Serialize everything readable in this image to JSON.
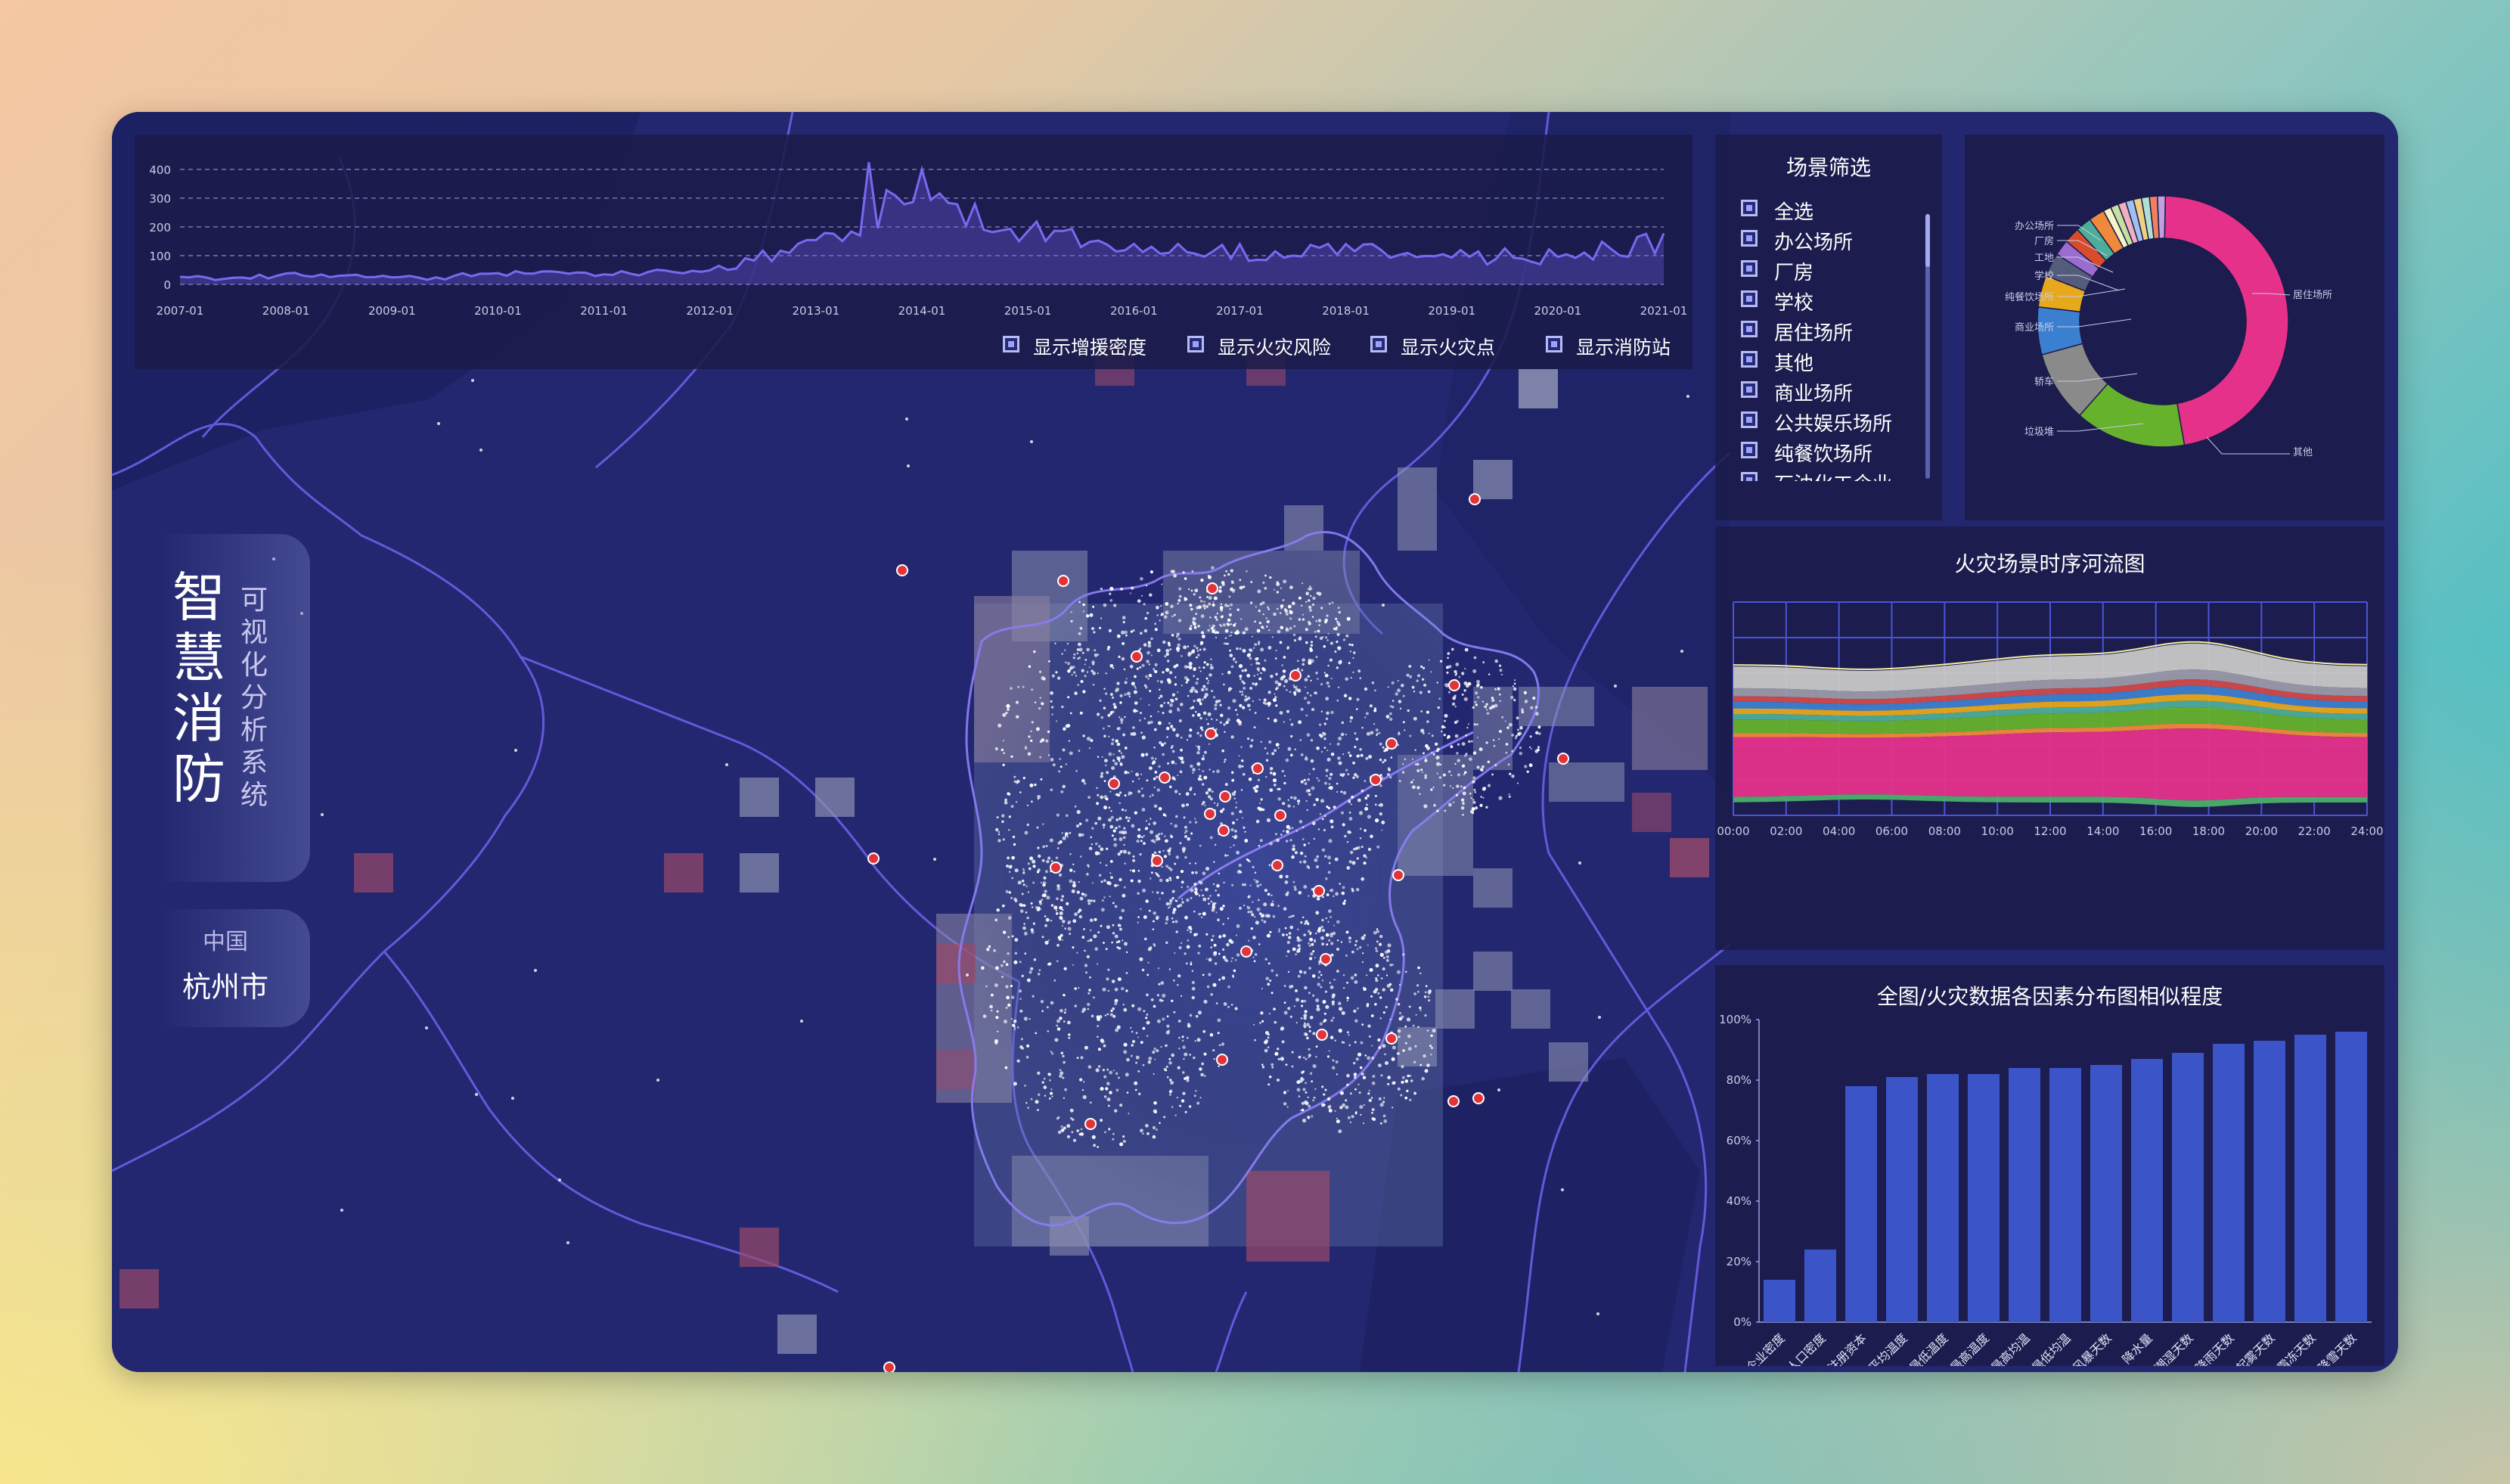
{
  "title": {
    "main": "智慧消防",
    "sub": "可视化分析系统"
  },
  "location": {
    "country": "中国",
    "city": "杭州市"
  },
  "timeline": {
    "y_ticks": [
      "400",
      "300",
      "200",
      "100",
      "0"
    ],
    "x_ticks": [
      "2007-01",
      "2008-01",
      "2009-01",
      "2010-01",
      "2011-01",
      "2012-01",
      "2013-01",
      "2014-01",
      "2015-01",
      "2016-01",
      "2017-01",
      "2018-01",
      "2019-01",
      "2020-01",
      "2021-01"
    ]
  },
  "toggles": [
    {
      "label": "显示增援密度"
    },
    {
      "label": "显示火灾风险"
    },
    {
      "label": "显示火灾点"
    },
    {
      "label": "显示消防站"
    }
  ],
  "filter": {
    "title": "场景筛选",
    "items": [
      "全选",
      "办公场所",
      "厂房",
      "学校",
      "居住场所",
      "其他",
      "商业场所",
      "公共娱乐场所",
      "纯餐饮场所",
      "石油化工企业"
    ]
  },
  "donut": {
    "labels_left": [
      "办公场所",
      "厂房",
      "工地",
      "学校",
      "纯餐饮场所",
      "商业场所",
      "轿车",
      "垃圾堆"
    ],
    "label_right_top": "居住场所",
    "label_right_bottom": "其他"
  },
  "river": {
    "title": "火灾场景时序河流图",
    "x_ticks": [
      "00:00",
      "02:00",
      "04:00",
      "06:00",
      "08:00",
      "10:00",
      "12:00",
      "14:00",
      "16:00",
      "18:00",
      "20:00",
      "22:00",
      "24:00"
    ]
  },
  "similarity": {
    "title": "全图/火灾数据各因素分布图相似程度",
    "y_ticks": [
      "100%",
      "80%",
      "60%",
      "40%",
      "20%",
      "0%"
    ]
  },
  "chart_data": [
    {
      "type": "line",
      "xlabel": "",
      "ylabel": "",
      "x": [
        "2007-01",
        "2008-01",
        "2009-01",
        "2010-01",
        "2011-01",
        "2012-01",
        "2013-01",
        "2014-01",
        "2015-01",
        "2016-01",
        "2017-01",
        "2018-01",
        "2019-01",
        "2020-01",
        "2021-01"
      ],
      "values": [
        20,
        30,
        25,
        35,
        40,
        45,
        160,
        330,
        180,
        130,
        110,
        120,
        95,
        100,
        150
      ],
      "ylim": [
        0,
        400
      ],
      "grid": true
    },
    {
      "type": "pie",
      "categories": [
        "居住场所",
        "其他",
        "垃圾堆",
        "轿车",
        "商业场所",
        "纯餐饮场所",
        "学校",
        "工地",
        "厂房",
        "办公场所"
      ],
      "values": [
        46,
        14,
        9,
        6,
        4,
        3,
        2,
        2,
        2,
        2
      ]
    },
    {
      "type": "area",
      "title": "火灾场景时序河流图",
      "x": [
        "00:00",
        "02:00",
        "04:00",
        "06:00",
        "08:00",
        "10:00",
        "12:00",
        "14:00",
        "16:00",
        "18:00",
        "20:00",
        "22:00",
        "24:00"
      ]
    },
    {
      "type": "bar",
      "title": "全图/火灾数据各因素分布图相似程度",
      "categories": [
        "企业密度",
        "人口密度",
        "平均注册资本",
        "平均温度",
        "最低温度",
        "最高温度",
        "最高均温",
        "最低均温",
        "风暴天数",
        "降水量",
        "潮湿天数",
        "降雨天数",
        "起雾天数",
        "霜冻天数",
        "降雪天数"
      ],
      "values": [
        14,
        24,
        78,
        81,
        82,
        82,
        84,
        84,
        85,
        87,
        89,
        92,
        93,
        95,
        96
      ],
      "ylim": [
        0,
        100
      ]
    }
  ],
  "colors": {
    "accent": "#6f5be8",
    "bar": "#3b55c9",
    "dot": "#e0343a",
    "pink": "#e5318a",
    "green": "#66b22d"
  }
}
